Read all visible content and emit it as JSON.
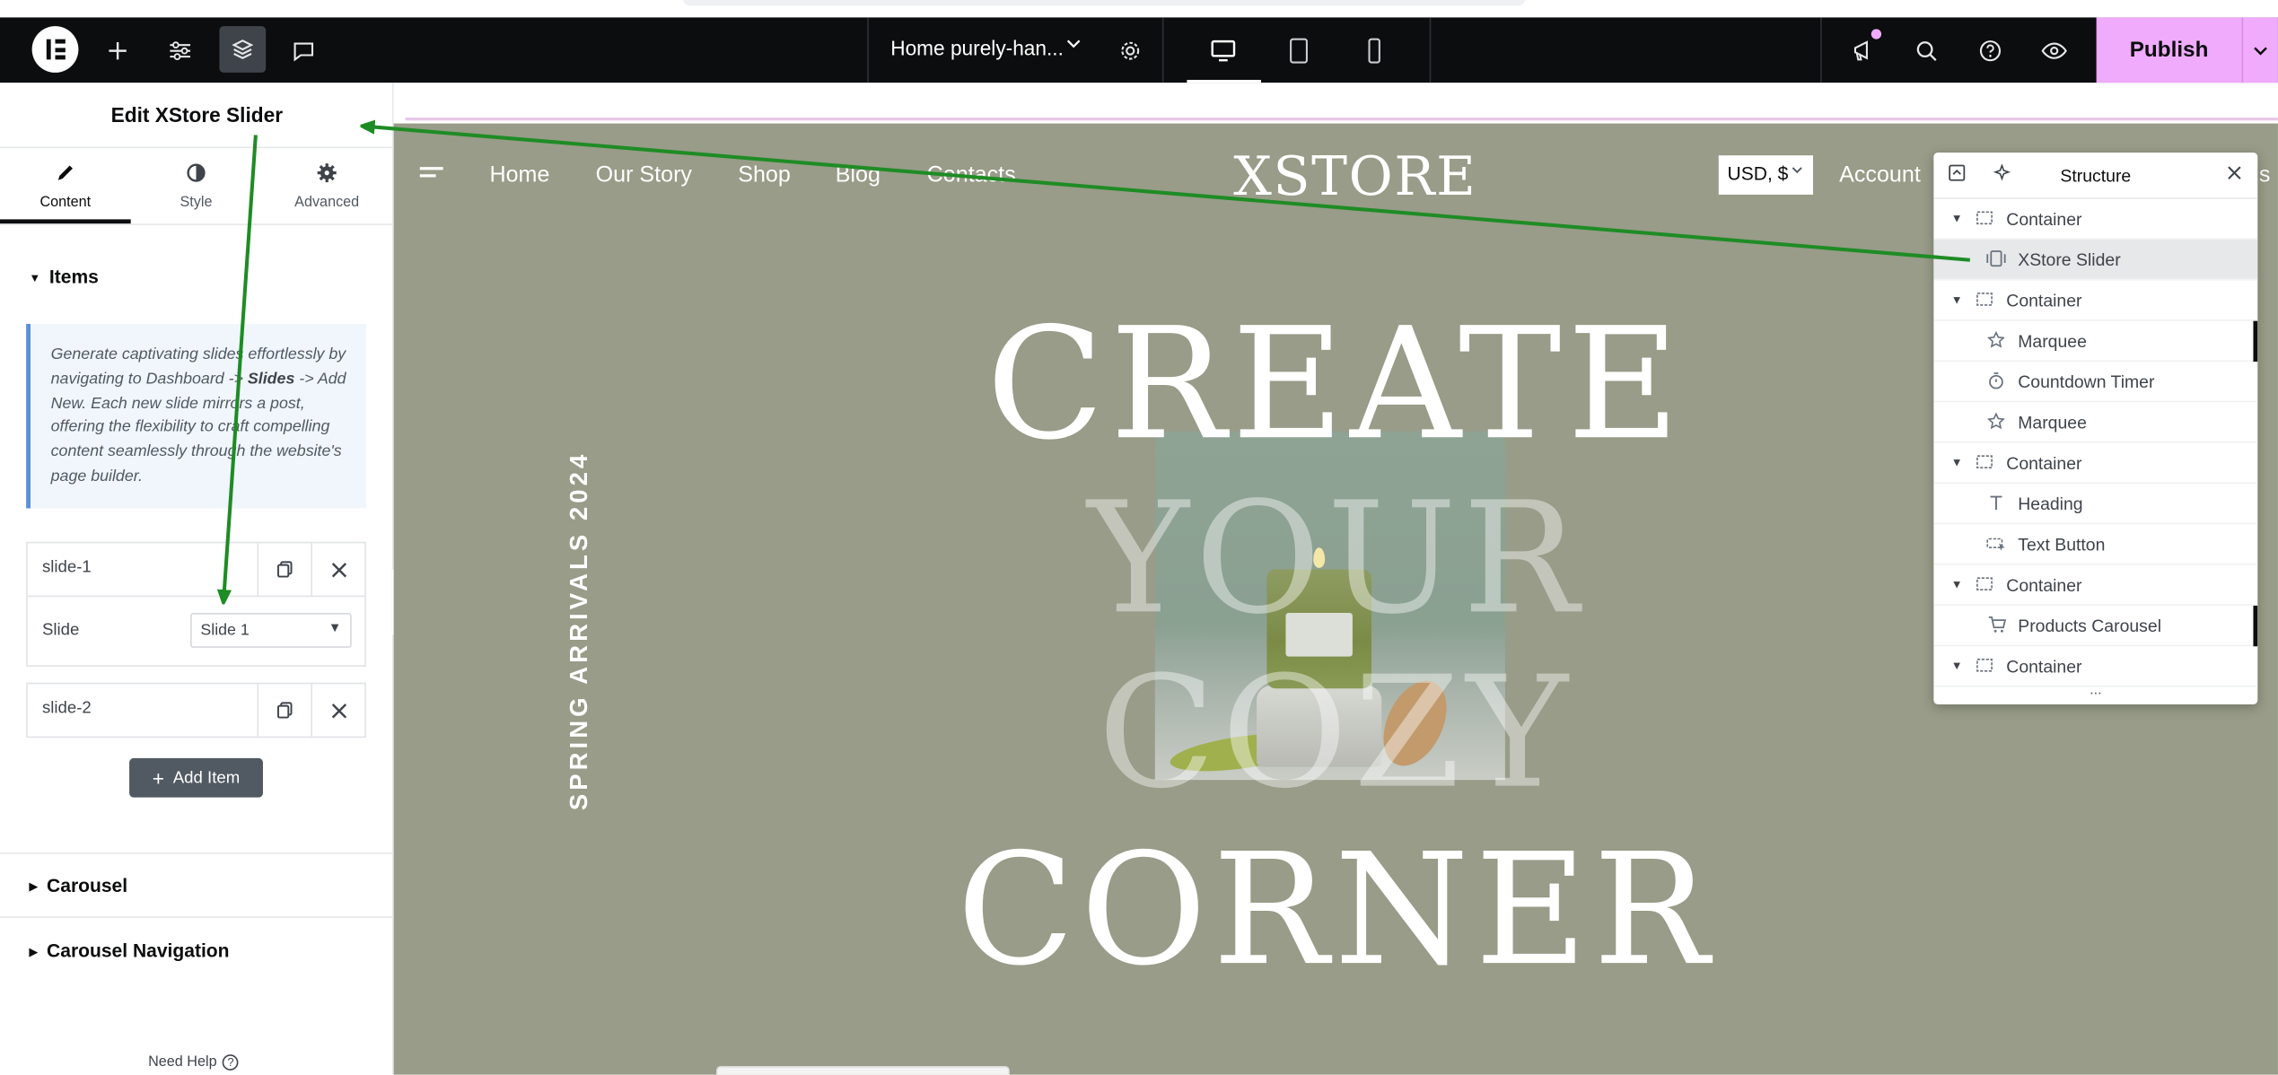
{
  "topbar": {
    "page_title": "Home purely-han...",
    "publish_label": "Publish",
    "icons": [
      "elementor-logo-icon",
      "add-icon",
      "settings-sliders-icon",
      "layers-icon",
      "comments-icon",
      "page-settings-gear-icon",
      "desktop-icon",
      "tablet-icon",
      "mobile-icon",
      "whats-new-icon",
      "search-icon",
      "help-icon",
      "preview-eye-icon",
      "chevron-down-icon"
    ],
    "accent_color": "#f0abfc"
  },
  "panel": {
    "title": "Edit XStore Slider",
    "tabs": [
      {
        "label": "Content",
        "icon": "pencil-icon",
        "active": true
      },
      {
        "label": "Style",
        "icon": "half-circle-icon",
        "active": false
      },
      {
        "label": "Advanced",
        "icon": "gear-icon",
        "active": false
      }
    ],
    "items_section": "Items",
    "notice": {
      "part1": "Generate captivating slides effortlessly by navigating to Dashboard -> ",
      "bold": "Slides",
      "part2": " -> Add New. Each new slide mirrors a post, offering the flexibility to craft compelling content seamlessly through the website's page builder."
    },
    "repeater": [
      {
        "title": "slide-1",
        "expanded": true,
        "field_label": "Slide",
        "field_value": "Slide 1"
      },
      {
        "title": "slide-2",
        "expanded": false
      }
    ],
    "add_item_label": "Add Item",
    "sections": [
      "Carousel",
      "Carousel Navigation"
    ],
    "need_help": "Need Help"
  },
  "preview": {
    "nav": [
      "Home",
      "Our Story",
      "Shop",
      "Blog",
      "Contacts"
    ],
    "brand": "XSTORE",
    "currency": "USD, $",
    "account": "Account",
    "right_clip": "s",
    "hero_lines": [
      "CREATE",
      "YOUR",
      "COZY",
      "CORNER"
    ],
    "vertical_text": "SPRING ARRIVALS 2024",
    "background_color": "#989c88"
  },
  "structure": {
    "title": "Structure",
    "items": [
      {
        "label": "Container",
        "level": 0,
        "icon": "container-icon",
        "selected": false
      },
      {
        "label": "XStore Slider",
        "level": 1,
        "icon": "slider-icon",
        "selected": true
      },
      {
        "label": "Container",
        "level": 0,
        "icon": "container-icon",
        "selected": false
      },
      {
        "label": "Marquee",
        "level": 1,
        "icon": "star-icon",
        "selected": false
      },
      {
        "label": "Countdown Timer",
        "level": 1,
        "icon": "timer-icon",
        "selected": false
      },
      {
        "label": "Marquee",
        "level": 1,
        "icon": "star-icon",
        "selected": false
      },
      {
        "label": "Container",
        "level": 0,
        "icon": "container-icon",
        "selected": false
      },
      {
        "label": "Heading",
        "level": 1,
        "icon": "heading-icon",
        "selected": false
      },
      {
        "label": "Text Button",
        "level": 1,
        "icon": "button-icon",
        "selected": false
      },
      {
        "label": "Container",
        "level": 0,
        "icon": "container-icon",
        "selected": false
      },
      {
        "label": "Products Carousel",
        "level": 1,
        "icon": "cart-icon",
        "selected": false
      },
      {
        "label": "Container",
        "level": 0,
        "icon": "container-icon",
        "selected": false
      }
    ]
  },
  "annotation_color": "#1e8c24"
}
